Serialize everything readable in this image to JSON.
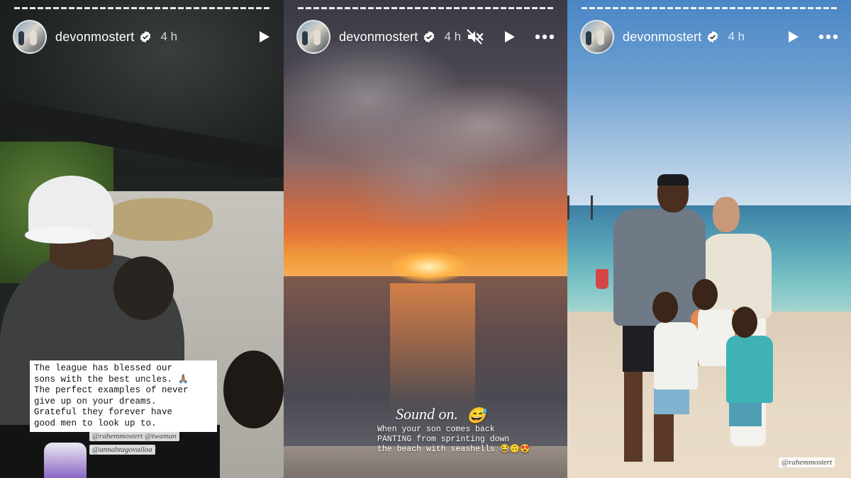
{
  "stories": [
    {
      "username": "devonmostert",
      "time": "4 h",
      "progress": [
        1.0,
        1.0,
        0.35
      ],
      "caption_lines": [
        "The league has blessed our",
        "sons with the best uncles. 🙏🏽",
        "The perfect examples of never",
        "give up on your dreams.",
        "Grateful they forever have",
        "good men to look up to."
      ],
      "mentions": [
        "@rahemmostert @twaman",
        "@annahtagovailoa"
      ],
      "icons": [
        "play-icon",
        "verified-icon"
      ]
    },
    {
      "username": "devonmostert",
      "time": "4 h",
      "headline": "Sound on.",
      "headline_emoji": "😅",
      "text_lines": [
        "When your son comes back",
        "PANTING from sprinting down",
        "the beach with seashells 😂🙃😍"
      ],
      "icons": [
        "mute-icon",
        "play-icon",
        "more-icon",
        "verified-icon"
      ]
    },
    {
      "username": "devonmostert",
      "time": "4 h",
      "mention": "@rahemmostert",
      "icons": [
        "play-icon",
        "more-icon",
        "verified-icon"
      ]
    }
  ],
  "colors": {
    "text": "#ffffff",
    "verified": "#ffffff"
  }
}
